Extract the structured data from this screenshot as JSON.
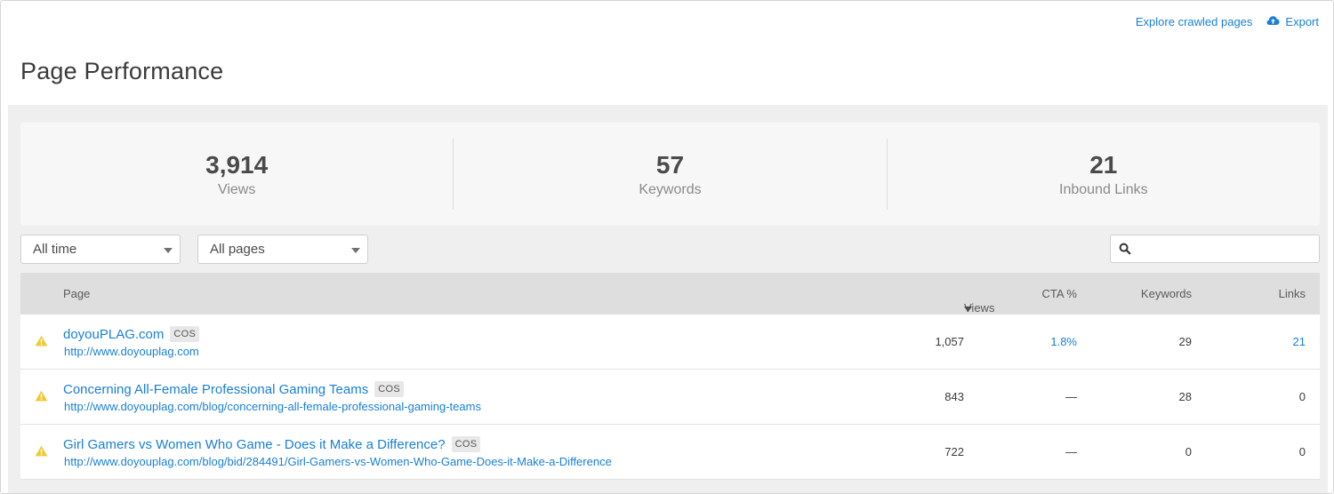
{
  "header": {
    "explore_label": "Explore crawled pages",
    "export_label": "Export",
    "page_title": "Page Performance"
  },
  "stats": [
    {
      "value": "3,914",
      "label": "Views"
    },
    {
      "value": "57",
      "label": "Keywords"
    },
    {
      "value": "21",
      "label": "Inbound Links"
    }
  ],
  "filters": {
    "time": "All time",
    "pages": "All pages",
    "search_placeholder": ""
  },
  "table": {
    "columns": {
      "page": "Page",
      "views": "Views",
      "cta": "CTA %",
      "keywords": "Keywords",
      "links": "Links"
    },
    "rows": [
      {
        "title": "doyouPLAG.com",
        "tag": "COS",
        "url": "http://www.doyouplag.com",
        "views": "1,057",
        "cta": "1.8%",
        "keywords": "29",
        "links": "21"
      },
      {
        "title": "Concerning All-Female Professional Gaming Teams",
        "tag": "COS",
        "url": "http://www.doyouplag.com/blog/concerning-all-female-professional-gaming-teams",
        "views": "843",
        "cta": "—",
        "keywords": "28",
        "links": "0"
      },
      {
        "title": "Girl Gamers vs Women Who Game - Does it Make a Difference?",
        "tag": "COS",
        "url": "http://www.doyouplag.com/blog/bid/284491/Girl-Gamers-vs-Women-Who-Game-Does-it-Make-a-Difference",
        "views": "722",
        "cta": "—",
        "keywords": "0",
        "links": "0"
      }
    ]
  },
  "colors": {
    "link": "#1a80d6",
    "warning": "#f0c93a",
    "header_bg": "#dedede"
  },
  "icons": {
    "export": "cloud-upload-icon",
    "search": "search-icon",
    "warning": "warning-icon",
    "sort": "sort-down-icon",
    "dropdown": "chevron-down-icon"
  }
}
